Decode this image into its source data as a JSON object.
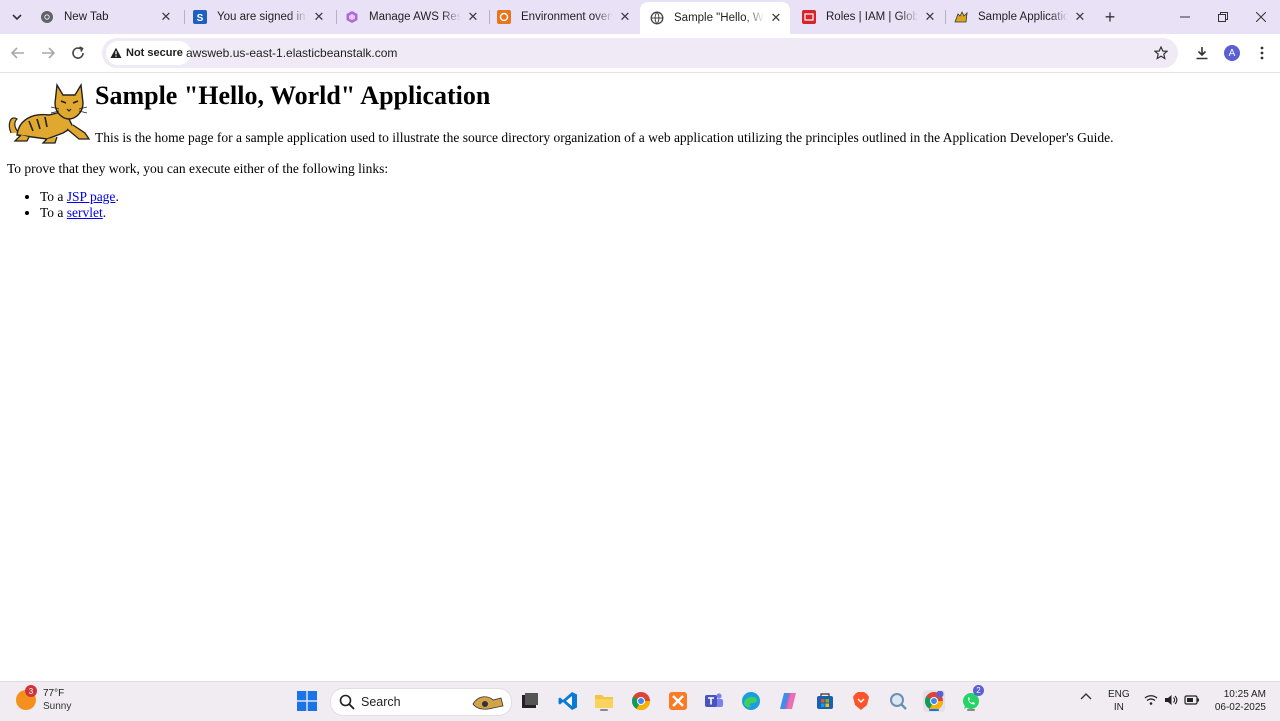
{
  "tabs": [
    {
      "title": "New Tab",
      "icon": "chrome-icon",
      "active": false
    },
    {
      "title": "You are signed in as",
      "icon": "s-icon",
      "active": false
    },
    {
      "title": "Manage AWS Resour",
      "icon": "aws-resource-icon",
      "active": false
    },
    {
      "title": "Environment overvie",
      "icon": "beanstalk-icon",
      "active": false
    },
    {
      "title": "Sample \"Hello, Worl",
      "icon": "globe-icon",
      "active": true
    },
    {
      "title": "Roles | IAM | Global",
      "icon": "iam-icon",
      "active": false
    },
    {
      "title": "Sample Application",
      "icon": "tomcat-icon",
      "active": false
    }
  ],
  "toolbar": {
    "security_label": "Not secure",
    "url": "awsweb.us-east-1.elasticbeanstalk.com",
    "avatar_letter": "A"
  },
  "page": {
    "heading": "Sample \"Hello, World\" Application",
    "intro": "This is the home page for a sample application used to illustrate the source directory organization of a web application utilizing the principles outlined in the Application Developer's Guide.",
    "prove_text": "To prove that they work, you can execute either of the following links:",
    "links": [
      {
        "prefix": "To a ",
        "link_text": "JSP page",
        "suffix": "."
      },
      {
        "prefix": "To a ",
        "link_text": "servlet",
        "suffix": "."
      }
    ]
  },
  "taskbar": {
    "weather_temp": "77°F",
    "weather_condition": "Sunny",
    "weather_badge": "3",
    "search_label": "Search",
    "lang_line1": "ENG",
    "lang_line2": "IN",
    "time": "10:25 AM",
    "date": "06-02-2025",
    "whatsapp_badge": "2"
  },
  "colors": {
    "tabstrip_bg": "#e9e1f5",
    "link": "#0000ee",
    "taskbar_bg": "#f0ecf1"
  }
}
